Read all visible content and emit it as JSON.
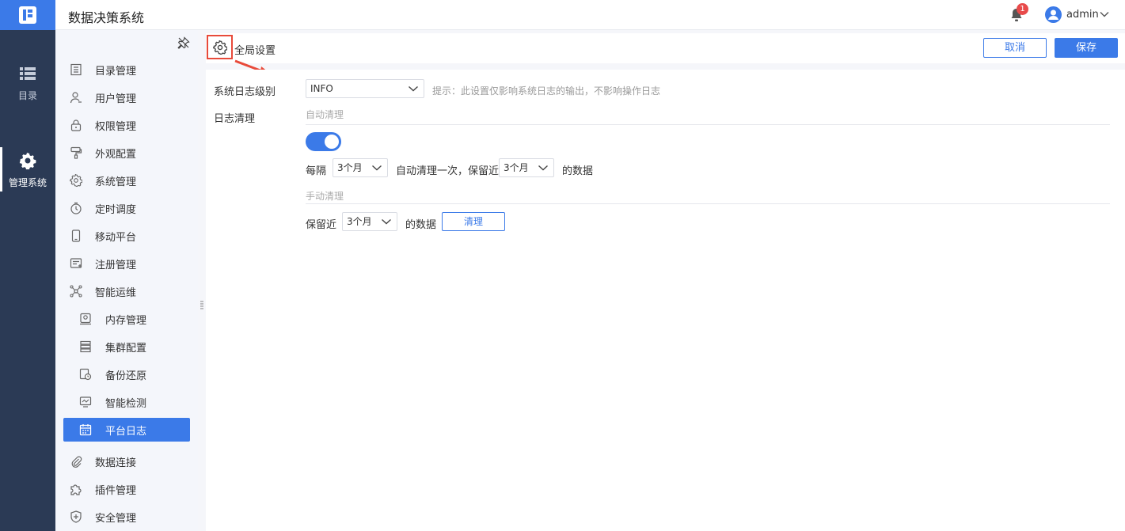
{
  "app": {
    "title": "数据决策系统"
  },
  "rail": {
    "items": [
      {
        "label": "目录",
        "icon": "list-icon"
      },
      {
        "label": "管理系统",
        "icon": "gear-icon"
      }
    ]
  },
  "header": {
    "notification_count": "1",
    "username": "admin"
  },
  "sidebar": {
    "items": [
      {
        "label": "目录管理",
        "icon": "catalog-icon"
      },
      {
        "label": "用户管理",
        "icon": "user-icon"
      },
      {
        "label": "权限管理",
        "icon": "lock-icon"
      },
      {
        "label": "外观配置",
        "icon": "paint-roller-icon"
      },
      {
        "label": "系统管理",
        "icon": "gear-icon"
      },
      {
        "label": "定时调度",
        "icon": "timer-icon"
      },
      {
        "label": "移动平台",
        "icon": "mobile-icon"
      },
      {
        "label": "注册管理",
        "icon": "register-icon"
      },
      {
        "label": "智能运维",
        "icon": "network-icon"
      },
      {
        "label": "内存管理",
        "icon": "memory-icon"
      },
      {
        "label": "集群配置",
        "icon": "server-icon"
      },
      {
        "label": "备份还原",
        "icon": "backup-icon"
      },
      {
        "label": "智能检测",
        "icon": "monitor-icon"
      },
      {
        "label": "平台日志",
        "icon": "calendar-icon"
      },
      {
        "label": "数据连接",
        "icon": "paperclip-icon"
      },
      {
        "label": "插件管理",
        "icon": "puzzle-icon"
      },
      {
        "label": "安全管理",
        "icon": "shield-icon"
      }
    ]
  },
  "toolbar": {
    "breadcrumb": "全局设置",
    "cancel_label": "取消",
    "save_label": "保存"
  },
  "settings": {
    "log_level_label": "系统日志级别",
    "log_level_value": "INFO",
    "log_level_hint": "提示：此设置仅影响系统日志的输出，不影响操作日志",
    "log_clean_label": "日志清理",
    "auto_clean": {
      "title": "自动清理",
      "enabled": true,
      "every_label": "每隔",
      "interval_value": "3个月",
      "mid_text": "自动清理一次，保留近",
      "keep_value": "3个月",
      "suffix": "的数据"
    },
    "manual_clean": {
      "title": "手动清理",
      "keep_label": "保留近",
      "keep_value": "3个月",
      "suffix": "的数据",
      "button_label": "清理"
    }
  },
  "colors": {
    "accent": "#3b7ae8",
    "rail_bg": "#2b3a55",
    "highlight_box": "#e84a3a"
  }
}
